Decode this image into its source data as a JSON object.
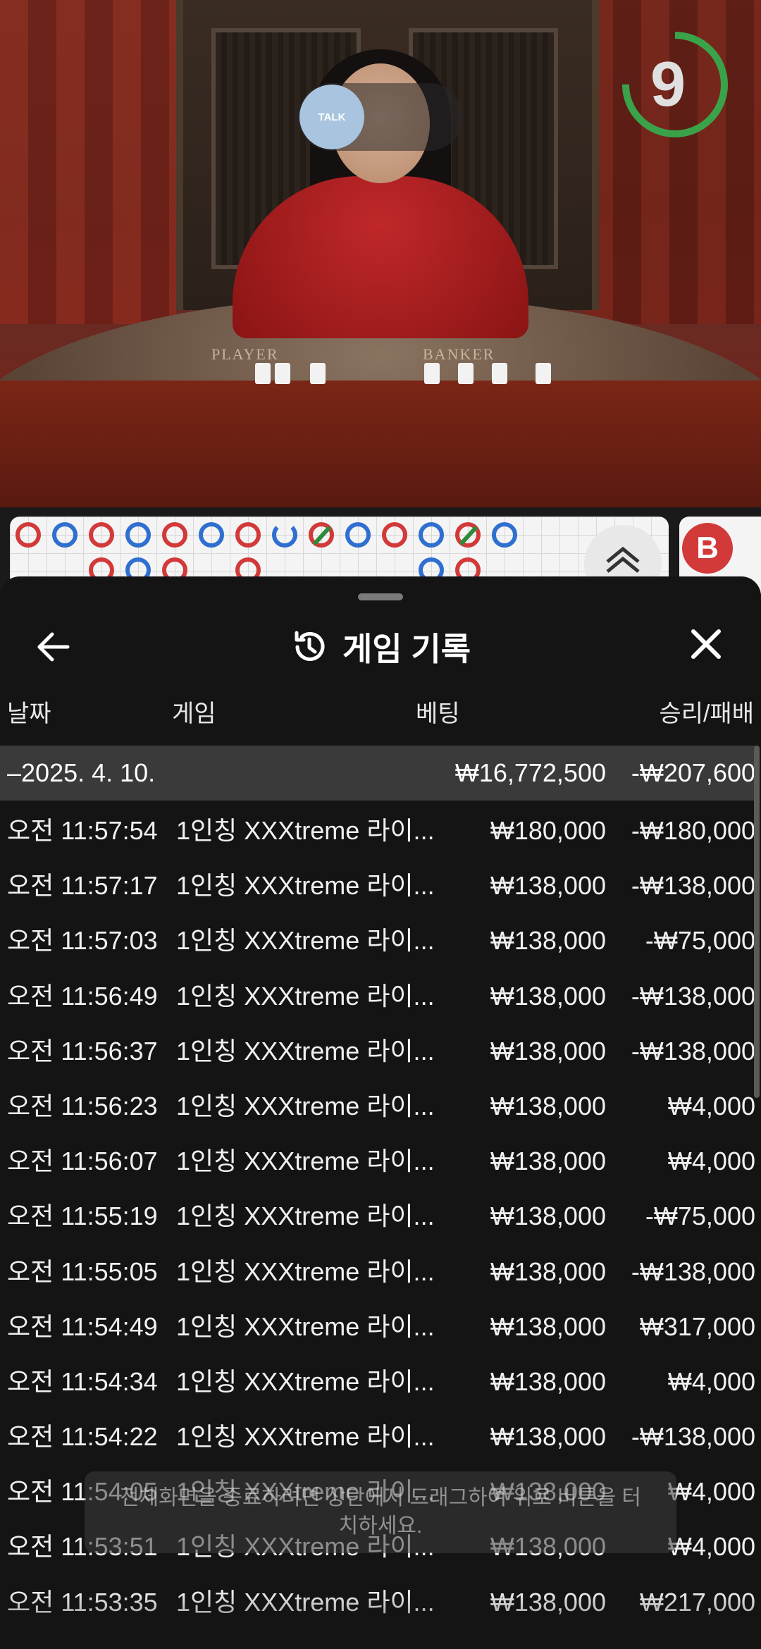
{
  "video": {
    "talk_label": "TALK",
    "timer_value": "9",
    "timer_color": "#3aa34a",
    "table_labels": [
      "PLAYER",
      "BANKER"
    ]
  },
  "roadmap": {
    "badge": "B",
    "colors": {
      "red": "#d23a3a",
      "blue": "#2f6fd0",
      "tie": "#2e8b3a"
    }
  },
  "sheet": {
    "title": "게임 기록",
    "icons": {
      "back": "back-arrow-icon",
      "history": "history-clock-icon",
      "close": "close-icon"
    },
    "columns": {
      "date": "날짜",
      "game": "게임",
      "bet": "베팅",
      "result": "승리/패배"
    },
    "date_group": {
      "date": "–2025. 4. 10.",
      "bet_total": "₩16,772,500",
      "result_total": "-₩207,600"
    },
    "rows": [
      {
        "time": "오전 11:57:54",
        "game": "1인칭 XXXtreme 라이...",
        "bet": "₩180,000",
        "result": "-₩180,000"
      },
      {
        "time": "오전 11:57:17",
        "game": "1인칭 XXXtreme 라이...",
        "bet": "₩138,000",
        "result": "-₩138,000"
      },
      {
        "time": "오전 11:57:03",
        "game": "1인칭 XXXtreme 라이...",
        "bet": "₩138,000",
        "result": "-₩75,000"
      },
      {
        "time": "오전 11:56:49",
        "game": "1인칭 XXXtreme 라이...",
        "bet": "₩138,000",
        "result": "-₩138,000"
      },
      {
        "time": "오전 11:56:37",
        "game": "1인칭 XXXtreme 라이...",
        "bet": "₩138,000",
        "result": "-₩138,000"
      },
      {
        "time": "오전 11:56:23",
        "game": "1인칭 XXXtreme 라이...",
        "bet": "₩138,000",
        "result": "₩4,000"
      },
      {
        "time": "오전 11:56:07",
        "game": "1인칭 XXXtreme 라이...",
        "bet": "₩138,000",
        "result": "₩4,000"
      },
      {
        "time": "오전 11:55:19",
        "game": "1인칭 XXXtreme 라이...",
        "bet": "₩138,000",
        "result": "-₩75,000"
      },
      {
        "time": "오전 11:55:05",
        "game": "1인칭 XXXtreme 라이...",
        "bet": "₩138,000",
        "result": "-₩138,000"
      },
      {
        "time": "오전 11:54:49",
        "game": "1인칭 XXXtreme 라이...",
        "bet": "₩138,000",
        "result": "₩317,000"
      },
      {
        "time": "오전 11:54:34",
        "game": "1인칭 XXXtreme 라이...",
        "bet": "₩138,000",
        "result": "₩4,000"
      },
      {
        "time": "오전 11:54:22",
        "game": "1인칭 XXXtreme 라이...",
        "bet": "₩138,000",
        "result": "-₩138,000"
      },
      {
        "time": "오전 11:54:05",
        "game": "1인칭 XXXtreme 라이...",
        "bet": "₩138,000",
        "result": "₩4,000"
      },
      {
        "time": "오전 11:53:51",
        "game": "1인칭 XXXtreme 라이...",
        "bet": "₩138,000",
        "result": "₩4,000"
      },
      {
        "time": "오전 11:53:35",
        "game": "1인칭 XXXtreme 라이...",
        "bet": "₩138,000",
        "result": "₩217,000"
      }
    ]
  },
  "toast": {
    "text": "전체화면을 종료하려면 상단에서 드래그하여 위로 버튼을 터치하세요."
  }
}
